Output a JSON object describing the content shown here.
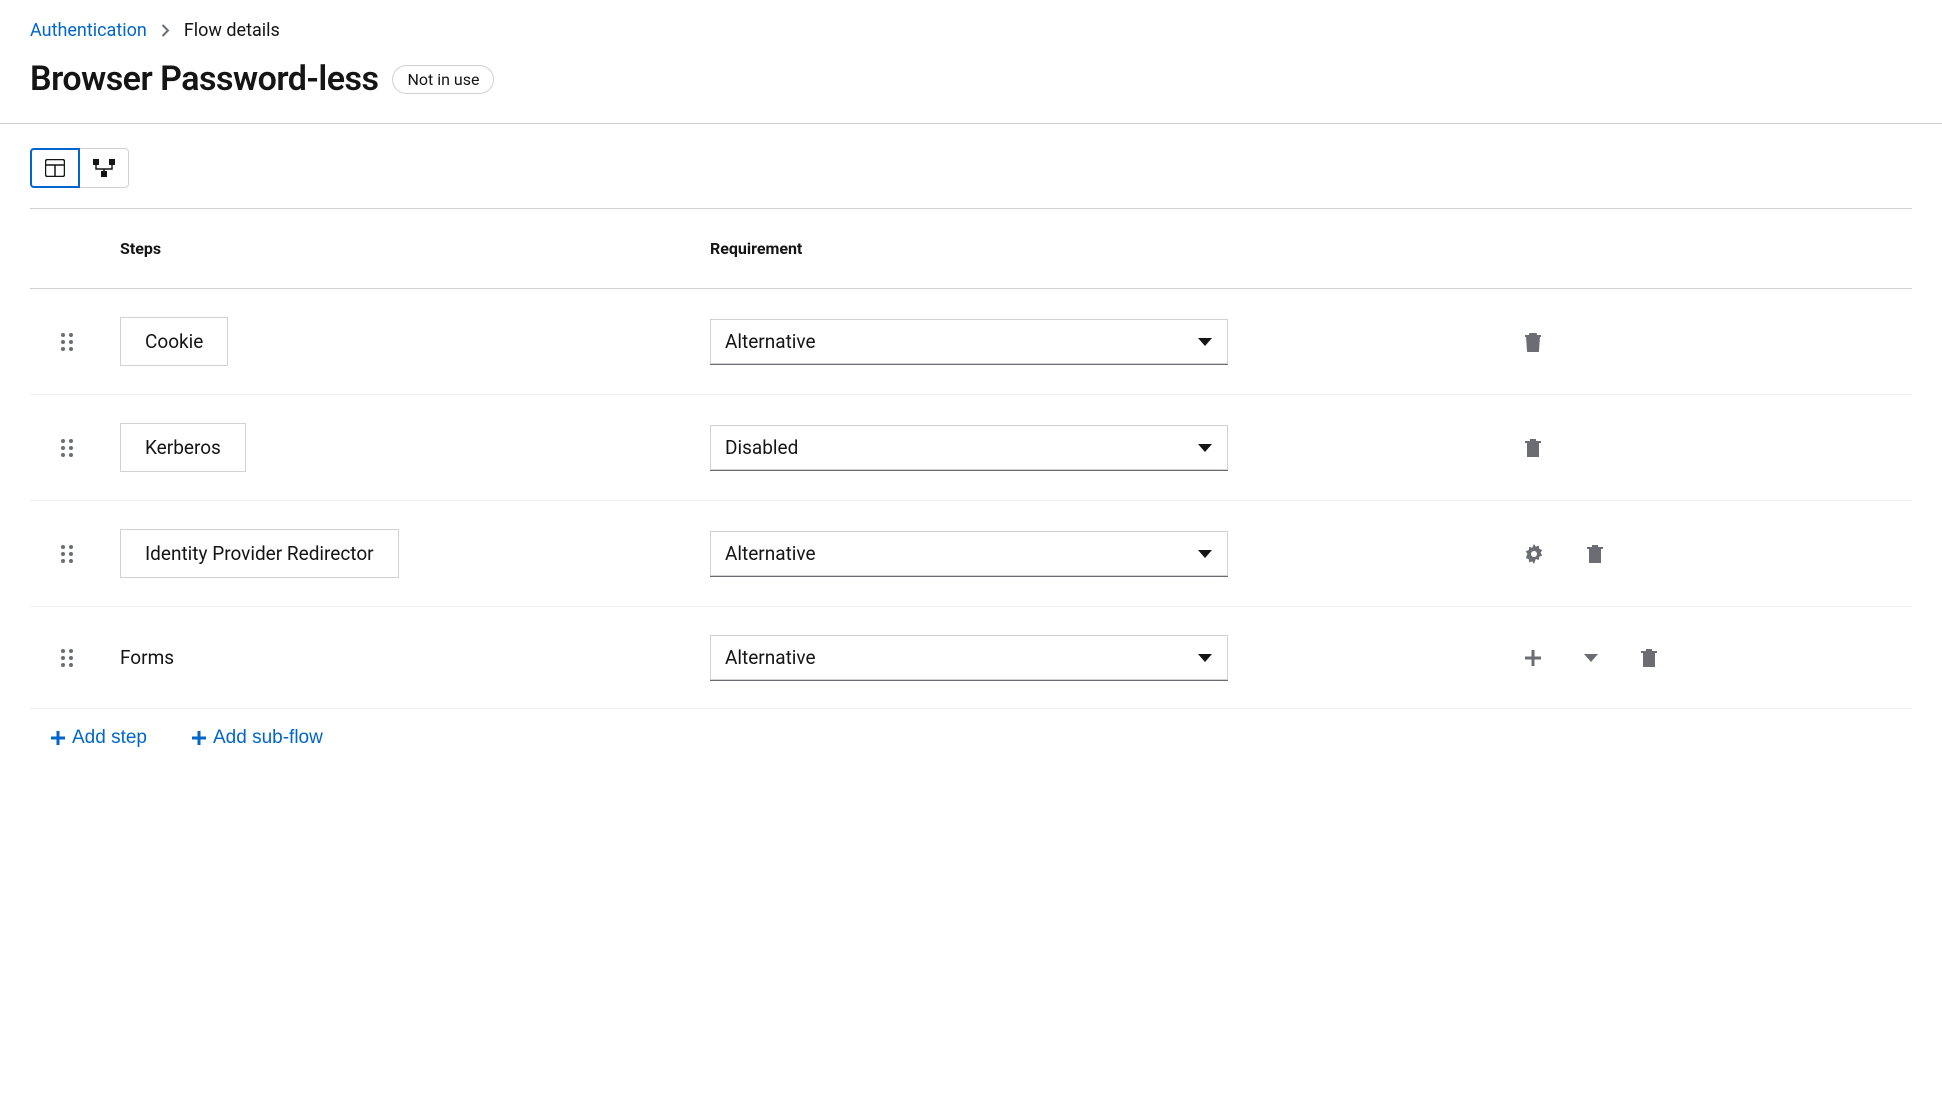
{
  "breadcrumb": {
    "parent": "Authentication",
    "current": "Flow details"
  },
  "title": "Browser Password-less",
  "status_badge": "Not in use",
  "columns": {
    "steps": "Steps",
    "requirement": "Requirement"
  },
  "rows": [
    {
      "label": "Cookie",
      "boxed": true,
      "requirement": "Alternative",
      "actions": [
        "trash"
      ]
    },
    {
      "label": "Kerberos",
      "boxed": true,
      "requirement": "Disabled",
      "actions": [
        "trash"
      ]
    },
    {
      "label": "Identity Provider Redirector",
      "boxed": true,
      "requirement": "Alternative",
      "actions": [
        "gear",
        "trash"
      ]
    },
    {
      "label": "Forms",
      "boxed": false,
      "requirement": "Alternative",
      "actions": [
        "plus",
        "dropdown",
        "trash"
      ]
    }
  ],
  "footer": {
    "add_step": "Add step",
    "add_subflow": "Add sub-flow"
  }
}
